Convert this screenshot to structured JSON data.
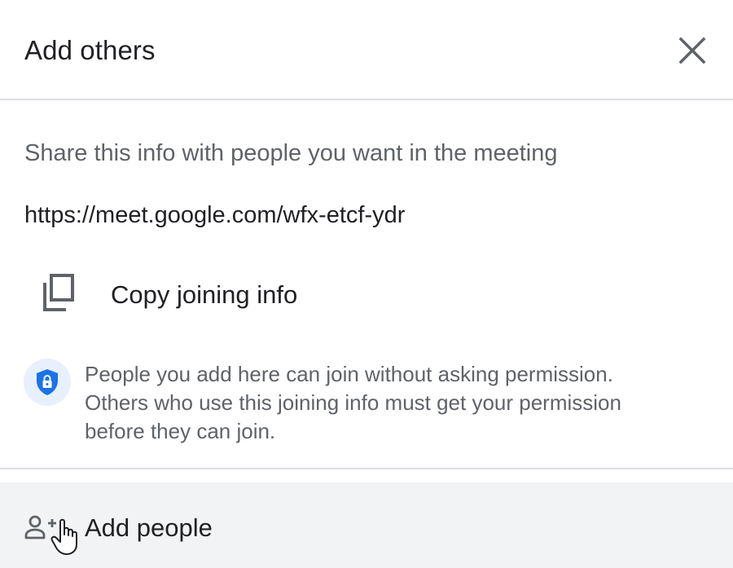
{
  "dialog": {
    "title": "Add others",
    "close_icon": "close-icon"
  },
  "share": {
    "instructions": "Share this info with people you want in the meeting",
    "meeting_link": "https://meet.google.com/wfx-etcf-ydr",
    "copy_label": "Copy joining info",
    "copy_icon": "copy-icon"
  },
  "notice": {
    "icon": "shield-lock-icon",
    "line1": "People you add here can join without asking permission.",
    "line2": "Others who use this joining info must get your permission",
    "line3": "before they can join."
  },
  "add_people": {
    "label": "Add people",
    "icon": "person-add-icon"
  },
  "colors": {
    "text_primary": "#202124",
    "text_secondary": "#5f6368",
    "divider": "#dadce0",
    "accent_blue": "#1a73e8",
    "notice_bg": "#e8f0fe",
    "row_hover_bg": "#f1f3f4"
  }
}
